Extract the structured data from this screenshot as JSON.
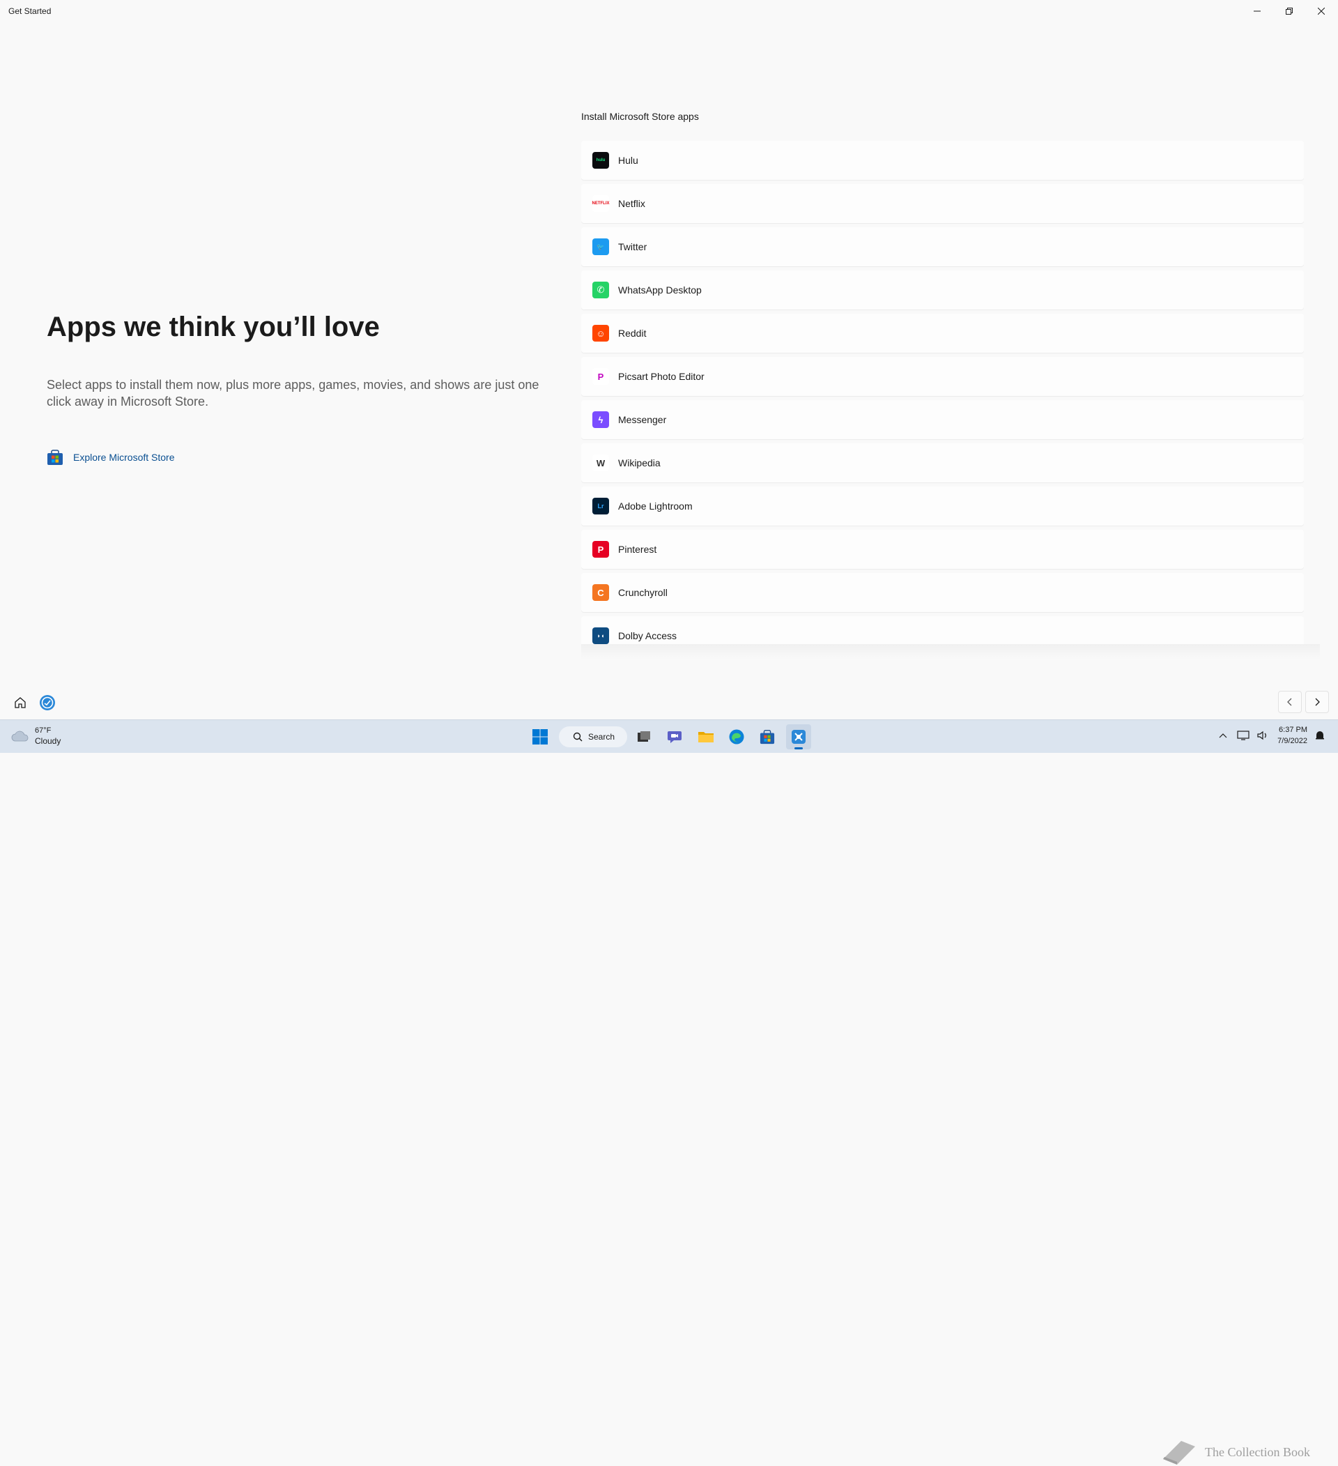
{
  "window": {
    "title": "Get Started",
    "controls": [
      "minimize",
      "restore",
      "close"
    ]
  },
  "hero": {
    "title": "Apps we think you’ll love",
    "description": "Select apps to install them now, plus more apps, games, movies, and shows are just one click away in Microsoft Store.",
    "explore_label": "Explore Microsoft Store"
  },
  "app_list": {
    "heading": "Install Microsoft Store apps",
    "items": [
      {
        "label": "Hulu",
        "icon": "hulu-icon",
        "color": "#0b0c0f",
        "glyph": "hulu",
        "glyph_color": "#1ce783"
      },
      {
        "label": "Netflix",
        "icon": "netflix-icon",
        "color": "#ffffff",
        "glyph": "NETFLIX",
        "glyph_color": "#e50914"
      },
      {
        "label": "Twitter",
        "icon": "twitter-icon",
        "color": "#1d9bf0",
        "glyph": "🐦",
        "glyph_color": "#ffffff"
      },
      {
        "label": "WhatsApp Desktop",
        "icon": "whatsapp-icon",
        "color": "#25d366",
        "glyph": "✆",
        "glyph_color": "#ffffff"
      },
      {
        "label": "Reddit",
        "icon": "reddit-icon",
        "color": "#ff4500",
        "glyph": "☺",
        "glyph_color": "#ffffff"
      },
      {
        "label": "Picsart Photo Editor",
        "icon": "picsart-icon",
        "color": "#ffffff",
        "glyph": "P",
        "glyph_color": "#c209c1"
      },
      {
        "label": "Messenger",
        "icon": "messenger-icon",
        "color": "#7b4dff",
        "glyph": "ϟ",
        "glyph_color": "#ffffff"
      },
      {
        "label": "Wikipedia",
        "icon": "wikipedia-icon",
        "color": "#ffffff",
        "glyph": "W",
        "glyph_color": "#333333"
      },
      {
        "label": "Adobe Lightroom",
        "icon": "lightroom-icon",
        "color": "#001e36",
        "glyph": "Lr",
        "glyph_color": "#31a8ff"
      },
      {
        "label": "Pinterest",
        "icon": "pinterest-icon",
        "color": "#e60023",
        "glyph": "P",
        "glyph_color": "#ffffff"
      },
      {
        "label": "Crunchyroll",
        "icon": "crunchyroll-icon",
        "color": "#f47521",
        "glyph": "C",
        "glyph_color": "#ffffff"
      },
      {
        "label": "Dolby Access",
        "icon": "dolby-icon",
        "color": "#0f4c81",
        "glyph": "◗◖",
        "glyph_color": "#ffffff"
      }
    ]
  },
  "taskbar": {
    "weather_temp": "67°F",
    "weather_desc": "Cloudy",
    "search_label": "Search",
    "time": "6:37 PM",
    "date": "7/9/2022",
    "watermark": "The Collection Book"
  },
  "colors": {
    "background": "#f9f9f9",
    "accent_link": "#0a4f91",
    "taskbar": "#dbe4ef"
  }
}
